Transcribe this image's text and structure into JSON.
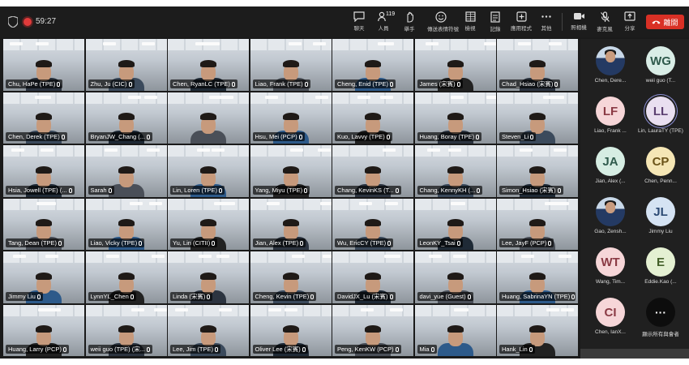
{
  "meeting": {
    "elapsed_time": "59:27"
  },
  "toolbar": {
    "chat": "聊天",
    "people": "人員",
    "people_count": "119",
    "raise_hand": "舉手",
    "reactions": "傳送表情符號",
    "view": "檢視",
    "notes": "記錄",
    "apps": "應用程式",
    "more": "其他",
    "camera": "照相機",
    "mic": "麥克風",
    "share": "分享",
    "leave": "離開"
  },
  "tiles": [
    [
      "Chu, HaPe (TPE)",
      "Zhu, Ju (CIC)",
      "Chen, RyanLC (TPE)",
      "Liao, Frank (TPE)",
      "Cheng, Enid (TPE)",
      "James (宋賓)",
      "Chad_Hsiao (宋賓)"
    ],
    [
      "Chen, Derek (TPE)",
      "BryanJW_Chang (...",
      "",
      "Hsu, Mei (PCP)",
      "Kuo, Lavvy (TPE)",
      "Huang, Boray (TPE)",
      "Steven_Li"
    ],
    [
      "Hsia, Jowell (TPE) (...",
      "Sarah",
      "Lin, Loren (TPE)",
      "Yang, Miyu (TPE)",
      "Chang, KevinKS (T...",
      "Chang, KennyKH (...",
      "Simon_Hsiao (宋賓)"
    ],
    [
      "Tang, Dean (TPE)",
      "Liao, Vicky (TPE)",
      "Yu, Lin (CITII)",
      "Jian, Alex (TPE)",
      "Wu, EricCY (TPE)",
      "LeonKY_Tsai",
      "Lee, JayF (PCP)"
    ],
    [
      "Jimmy Liu",
      "LynnYL_Chen",
      "Linda (宋賓)",
      "Cheng, Kevin (TPE)",
      "DavidJX_Lu (宋賓)",
      "davi_yue (Guest)",
      "Huang, SabrinaYN (TPE)"
    ],
    [
      "Huang, Larry (PCP)",
      "weii guo (TPE) (宋...",
      "Lee, Jim (TPE)",
      "Oliver Lee (宋賓)",
      "Peng, KenKW (PCP)",
      "Mia",
      "Hank_Lin"
    ]
  ],
  "panel": [
    {
      "initials": "",
      "name": "Chen, Dere...",
      "bg": "photo"
    },
    {
      "initials": "WG",
      "name": "weii guo (T...",
      "bg": "#d9ede6",
      "fg": "#2f5a4c"
    },
    {
      "initials": "LF",
      "name": "Liao, Frank ...",
      "bg": "#f6d6d8",
      "fg": "#8a3a44"
    },
    {
      "initials": "LL",
      "name": "Lin, LauraTY (TPE)",
      "bg": "#e9dff0",
      "fg": "#5b3f70"
    },
    {
      "initials": "JA",
      "name": "Jian, Alex (...",
      "bg": "#d6ede3",
      "fg": "#2f5a4c"
    },
    {
      "initials": "CP",
      "name": "Chen, Penn...",
      "bg": "#f5e6b5",
      "fg": "#6b5318"
    },
    {
      "initials": "",
      "name": "Gao, Zensh...",
      "bg": "photo"
    },
    {
      "initials": "JL",
      "name": "Jimmy Liu",
      "bg": "#d5e3f3",
      "fg": "#2c4a73"
    },
    {
      "initials": "WT",
      "name": "Wang, Tim...",
      "bg": "#f6d6d8",
      "fg": "#8a3a44"
    },
    {
      "initials": "E",
      "name": "Eddie.Kao (...",
      "bg": "#e4f0d2",
      "fg": "#44602a"
    },
    {
      "initials": "CI",
      "name": "Chen, IanX...",
      "bg": "#f6d6d8",
      "fg": "#8a3a44"
    },
    {
      "initials": "···",
      "name": "顯示所有與會者",
      "bg": "more"
    }
  ]
}
